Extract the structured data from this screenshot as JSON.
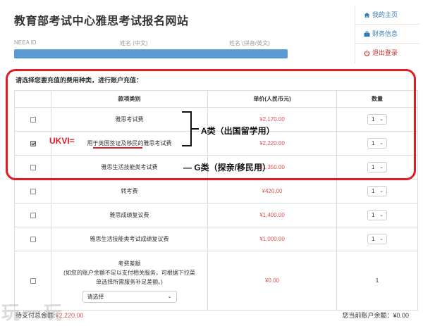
{
  "header": {
    "title": "教育部考试中心雅思考试报名网站"
  },
  "user_info": {
    "labels": [
      "NEEA ID",
      "姓名 (中文)",
      "姓名 (拼音/英文)"
    ]
  },
  "side_menu": {
    "items": [
      {
        "label": "我的主页",
        "icon": "home-icon"
      },
      {
        "label": "财务信息",
        "icon": "briefcase-icon"
      },
      {
        "label": "退出登录",
        "icon": "power-icon"
      }
    ]
  },
  "prompt": "请选择您要充值的费用种类，进行账户充值：",
  "table": {
    "headers": [
      "款项类别",
      "单价(人民币元)",
      "数量"
    ],
    "rows": [
      {
        "name": "雅思考试费",
        "price": "¥2,170.00",
        "qty": "1",
        "checked": false
      },
      {
        "name": "用于英国签证及移民的雅思考试费",
        "price": "¥2,220.00",
        "qty": "1",
        "checked": true
      },
      {
        "name": "雅思生活技能类考试费",
        "price": "¥1,350.00",
        "qty": "1",
        "checked": false
      },
      {
        "name": "转考费",
        "price": "¥420.00",
        "qty": "1",
        "checked": false
      },
      {
        "name": "雅思成绩复议费",
        "price": "¥1,400.00",
        "qty": "1",
        "checked": false
      },
      {
        "name": "雅思生活技能类考试成绩复议费",
        "price": "¥1,000.00",
        "qty": "1",
        "checked": false
      }
    ],
    "difference_row": {
      "title": "考费差额",
      "note_line1": "(如您的账户余额不足以支付相关服务，可根据下拉菜",
      "note_line2": "单选择所需服务补足差额。)",
      "select_placeholder": "请选择",
      "price": "¥0.00",
      "qty": "1",
      "checked": false
    }
  },
  "footer": {
    "total_label": "待支付总金额:",
    "total_value": "¥2,220.00",
    "balance": "您当前账户余额：¥0.00"
  },
  "annotations": {
    "ukvi": "UKVI=",
    "class_a": "A类（出国留学用）",
    "class_g": "— G类（探亲/移民用）"
  },
  "watermark": "玩一玩",
  "colors": {
    "accent": "#e01c24",
    "link": "#337ab7",
    "price": "#d9534f",
    "bar": "#5b9bd5"
  }
}
